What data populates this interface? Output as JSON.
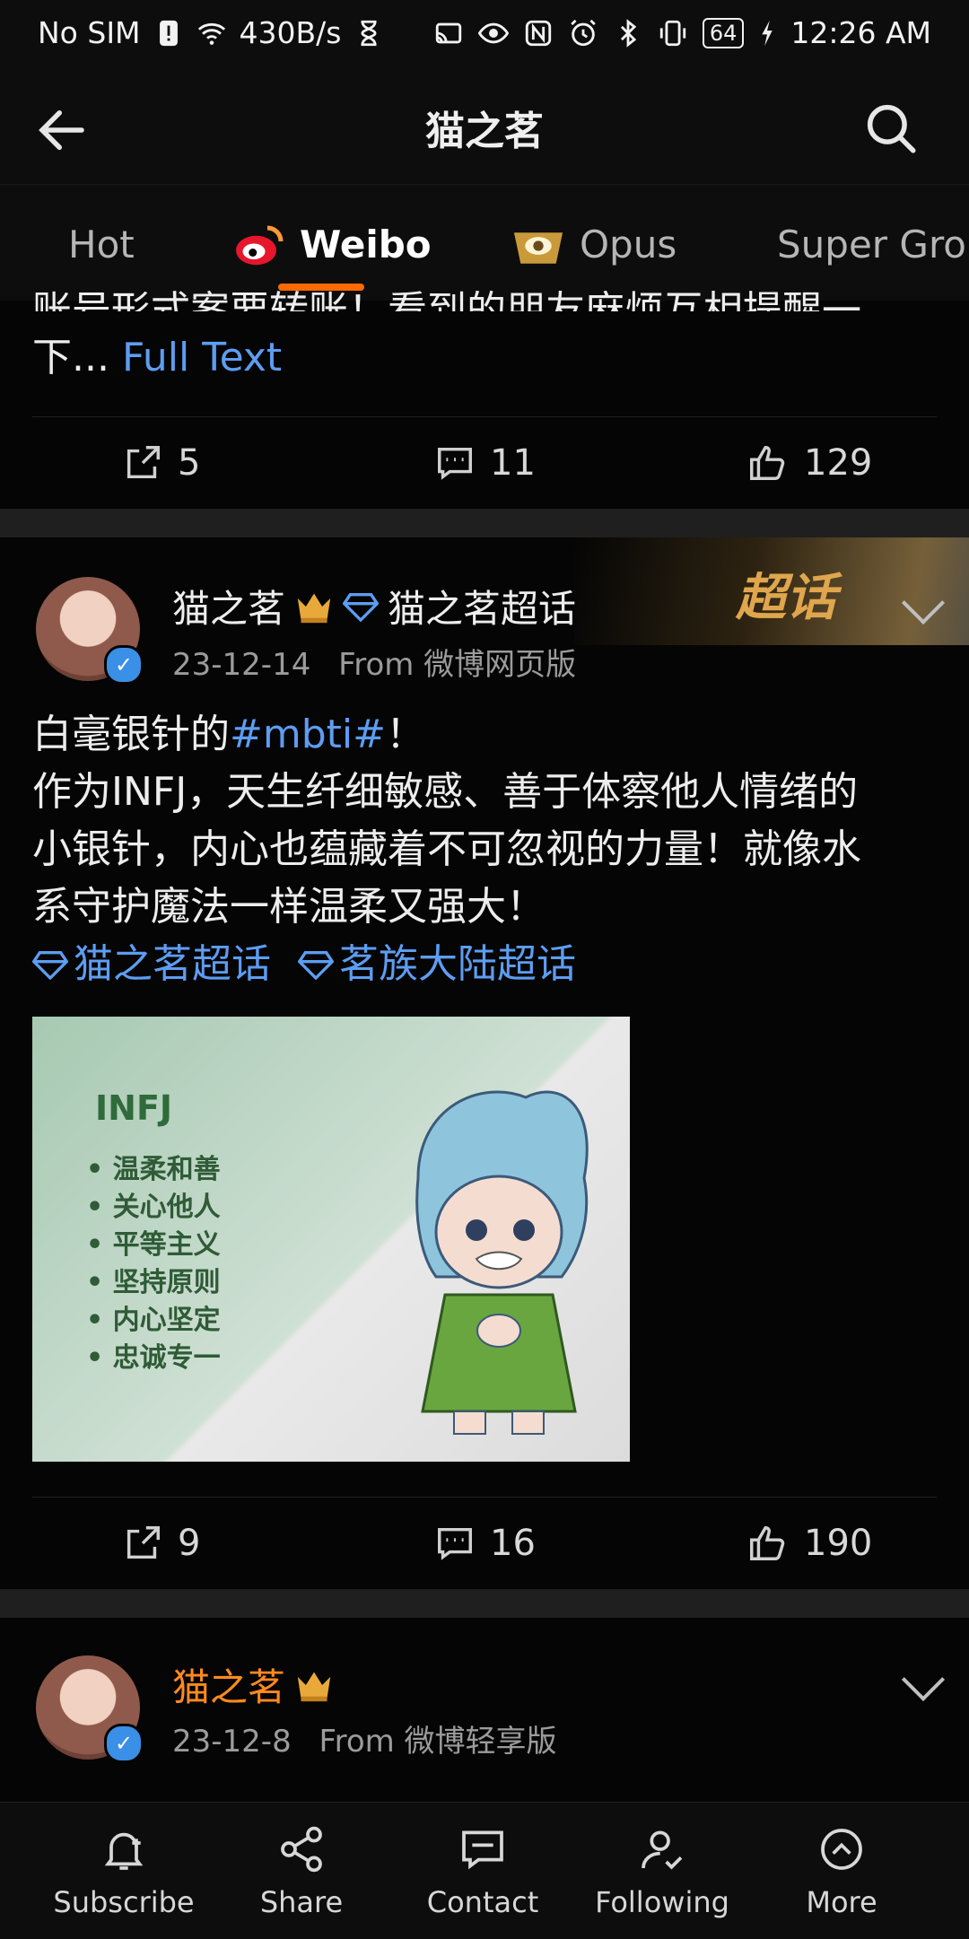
{
  "status_bar": {
    "carrier": "No SIM",
    "speed": "430B/s",
    "battery": "64",
    "time": "12:26 AM"
  },
  "header": {
    "title": "猫之茗",
    "back_icon": "arrow-left-icon",
    "search_icon": "search-icon"
  },
  "tabs": [
    {
      "label": "Hot"
    },
    {
      "label": "Weibo"
    },
    {
      "label": "Opus"
    },
    {
      "label": "Super Grou"
    }
  ],
  "post_prev": {
    "text_line1": "账号形式案要转账！看到的朋友麻烦互相提醒一",
    "text_line2": "下...",
    "full_text": "Full Text",
    "reposts": "5",
    "comments": "11",
    "likes": "129"
  },
  "post_main": {
    "author": "猫之茗",
    "supertopic_link": "猫之茗超话",
    "badge_text": "超话",
    "date": "23-12-14",
    "source": "From 微博网页版",
    "text_l1_a": "白毫银针的",
    "text_l1_tag": "#mbti#",
    "text_l1_b": "！",
    "text_l2": "作为INFJ，天生纤细敏感、善于体察他人情绪的",
    "text_l3": "小银针，内心也蕴藏着不可忽视的力量！就像水",
    "text_l4": "系守护魔法一样温柔又强大！",
    "topic1": "猫之茗超话",
    "topic2": "茗族大陆超话",
    "image": {
      "label": "INFJ",
      "items": [
        "温柔和善",
        "关心他人",
        "平等主义",
        "坚持原则",
        "内心坚定",
        "忠诚专一"
      ]
    },
    "reposts": "9",
    "comments": "16",
    "likes": "190"
  },
  "post_next": {
    "author": "猫之茗",
    "date": "23-12-8",
    "source": "From 微博轻享版"
  },
  "bottom_nav": [
    {
      "label": "Subscribe",
      "icon": "bell-plus-icon"
    },
    {
      "label": "Share",
      "icon": "share-icon"
    },
    {
      "label": "Contact",
      "icon": "chat-icon"
    },
    {
      "label": "Following",
      "icon": "user-check-icon"
    },
    {
      "label": "More",
      "icon": "more-circle-icon"
    }
  ],
  "colors": {
    "accent": "#ff6a00",
    "link": "#5d9df2",
    "next_author": "#ff8a1f",
    "gold": "#e0a64d"
  }
}
